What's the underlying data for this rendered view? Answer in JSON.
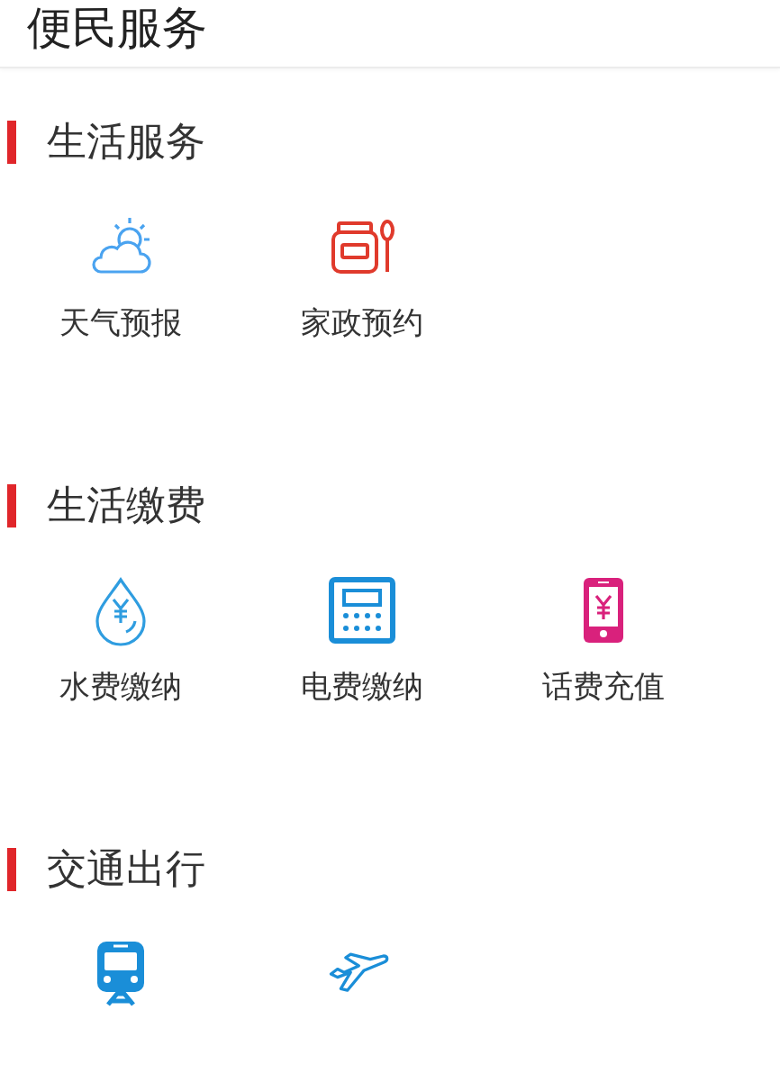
{
  "header": {
    "title": "便民服务"
  },
  "sections": [
    {
      "title": "生活服务",
      "items": [
        {
          "kind": "weather",
          "label": "天气预报"
        },
        {
          "kind": "housekeeping",
          "label": "家政预约"
        }
      ]
    },
    {
      "title": "生活缴费",
      "items": [
        {
          "kind": "water",
          "label": "水费缴纳"
        },
        {
          "kind": "electricity",
          "label": "电费缴纳"
        },
        {
          "kind": "phone",
          "label": "话费充值"
        }
      ]
    },
    {
      "title": "交通出行",
      "items": [
        {
          "kind": "train"
        },
        {
          "kind": "plane"
        }
      ]
    }
  ]
}
